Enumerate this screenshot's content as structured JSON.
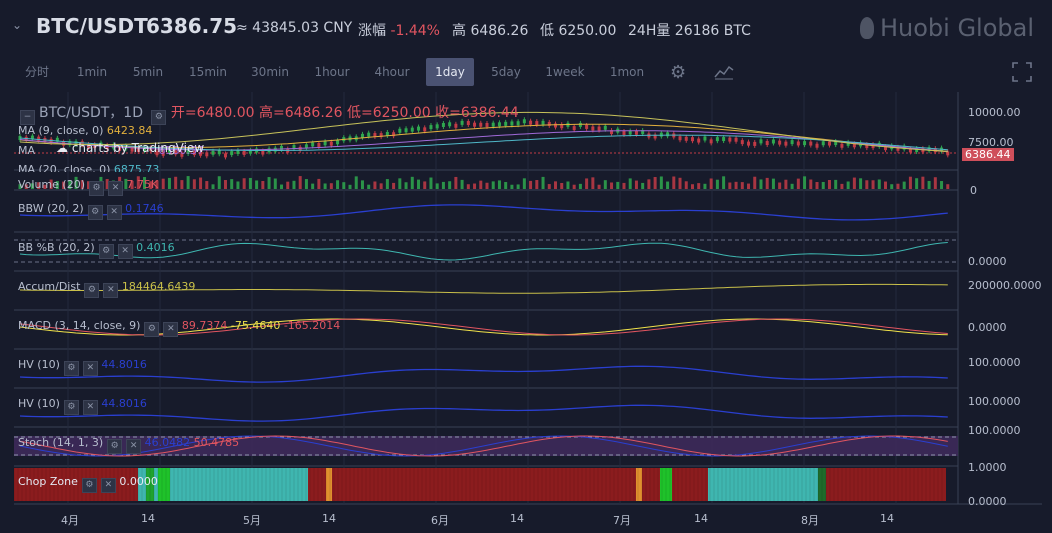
{
  "header": {
    "pair": "BTC/USDT",
    "price": "6386.75",
    "cny": "≈ 43845.03 CNY",
    "change_label": "涨幅",
    "change_value": "-1.44%",
    "high_label": "高",
    "high_value": "6486.26",
    "low_label": "低",
    "low_value": "6250.00",
    "vol_label": "24H量",
    "vol_value": "26186 BTC",
    "logo_text": "Huobi Global"
  },
  "timeframes": [
    "分时",
    "1min",
    "5min",
    "15min",
    "30min",
    "1hour",
    "4hour",
    "1day",
    "5day",
    "1week",
    "1mon"
  ],
  "active_timeframe": "1day",
  "colors": {
    "up": "#2fa84f",
    "down": "#c23b46",
    "bg": "#171b2b",
    "accent": "#cf4f5b"
  },
  "panes": {
    "main": {
      "title": "BTC/USDT，1D",
      "open": "开=6480.00",
      "high": "高=6486.26",
      "low": "低=6250.00",
      "close": "收=6386.44",
      "ma1": "MA (9, close, 0)",
      "ma1_val": "6423.84",
      "ma2": "MA",
      "ma2_val": "6580.37",
      "ma3": "MA (20, close, 0)",
      "ma3_val": "6875.73",
      "watermark": "charts by TradingView",
      "price_tag": "6386.44",
      "y_ticks": [
        "10000.00",
        "7500.00"
      ]
    },
    "volume": {
      "label": "Volume (20)",
      "value": "7.75K",
      "y_tick": "0"
    },
    "bbw": {
      "label": "BBW (20, 2)",
      "value": "0.1746"
    },
    "bbb": {
      "label": "BB %B (20, 2)",
      "value": "0.4016",
      "y_tick": "0.0000"
    },
    "accum": {
      "label": "Accum/Dist",
      "value": "184464.6439",
      "y_tick": "200000.0000"
    },
    "macd": {
      "label": "MACD (3, 14, close, 9)",
      "v1": "89.7374",
      "v2": "-75.4640",
      "v3": "-165.2014",
      "y_tick": "0.0000"
    },
    "hv1": {
      "label": "HV (10)",
      "value": "44.8016",
      "y_tick": "100.0000"
    },
    "hv2": {
      "label": "HV (10)",
      "value": "44.8016",
      "y_tick": "100.0000"
    },
    "stoch": {
      "label": "Stoch (14, 1, 3)",
      "v1": "46.0482",
      "v2": "50.4785",
      "y_tick": "100.0000"
    },
    "chop": {
      "label": "Chop Zone",
      "value": "0.0000",
      "y_ticks": [
        "1.0000",
        "0.0000"
      ]
    }
  },
  "x_labels": [
    "4月",
    "14",
    "5月",
    "14",
    "6月",
    "14",
    "7月",
    "14",
    "8月",
    "14"
  ]
}
